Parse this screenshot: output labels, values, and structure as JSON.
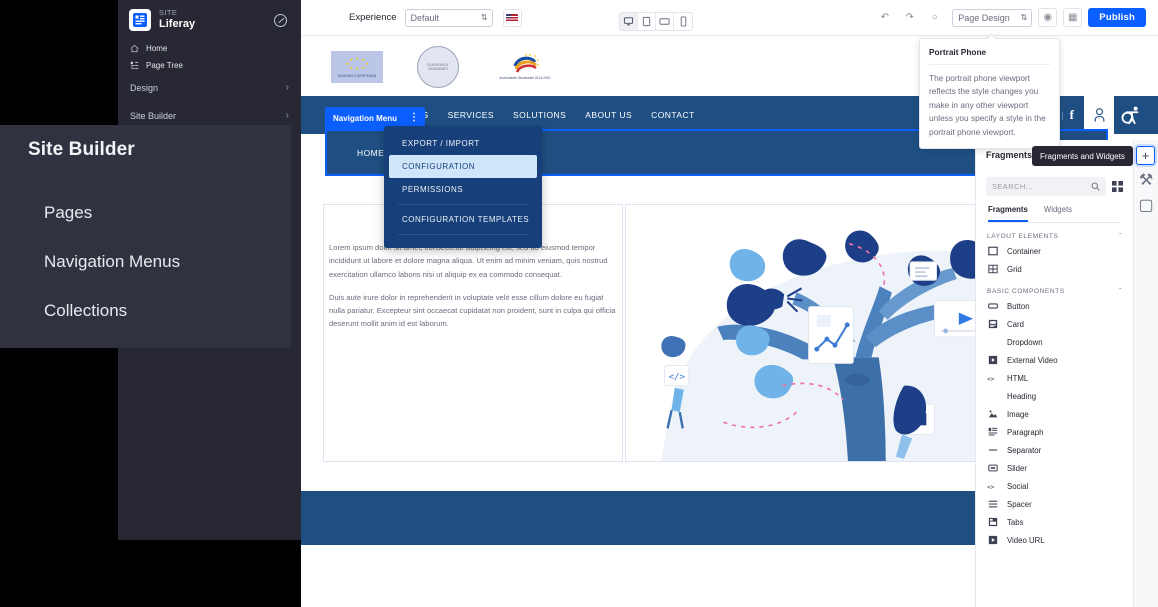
{
  "product_sidebar": {
    "kicker": "SITE",
    "site_name": "Liferay",
    "links": [
      {
        "label": "Home",
        "icon": "home-icon"
      },
      {
        "label": "Page Tree",
        "icon": "page-tree-icon"
      }
    ],
    "sections": [
      {
        "label": "Design",
        "chevron": "›"
      },
      {
        "label": "Site Builder",
        "chevron": "›"
      }
    ],
    "chevrons": [
      "›",
      "›",
      "›",
      "›",
      "›",
      "›"
    ]
  },
  "zoom_overlay": {
    "title": "Site Builder",
    "items": [
      "Pages",
      "Navigation Menus",
      "Collections"
    ]
  },
  "toolbar": {
    "experience_label": "Experience",
    "experience_value": "Default",
    "language_flag": "us-flag-icon",
    "viewports": [
      {
        "name": "desktop",
        "active": true
      },
      {
        "name": "tablet",
        "active": false
      },
      {
        "name": "landscape-phone",
        "active": false
      },
      {
        "name": "portrait-phone",
        "active": false
      }
    ],
    "undo": "↶",
    "redo": "↷",
    "history": "○",
    "page_design_value": "Page Design",
    "preview": "◉",
    "grid": "▦",
    "publish_label": "Publish"
  },
  "viewport_tooltip": {
    "title": "Portrait Phone",
    "body": "The portrait phone viewport reflects the style changes you make in any other viewport unless you specify a style in the portrait phone viewport."
  },
  "canvas": {
    "logos": [
      {
        "name": "eu-flag-logo",
        "caption": "UNIUNEA EUROPEANĂ"
      },
      {
        "name": "romania-government-seal",
        "caption": "GUVERNUL ROMÂNIEI"
      },
      {
        "name": "structural-instruments-logo",
        "caption": "Instrumente Structurale 2014-2020"
      }
    ],
    "nav_items": [
      "HOME",
      "PRODUCTS",
      "SERVICES",
      "SOLUTIONS",
      "ABOUT US",
      "CONTACT"
    ],
    "search_placeholder": "SEARCH...",
    "social": [
      "linkedin-icon",
      "youtube-icon",
      "facebook-icon"
    ],
    "user_icon": "user-account-icon",
    "accessibility_icon": "accessibility-icon",
    "fragment_label": "Navigation Menu",
    "fragment_kebab": "⋮",
    "second_nav_items": [
      "HOME",
      "P"
    ],
    "dropdown_items": [
      {
        "label": "EXPORT / IMPORT",
        "selected": false
      },
      {
        "label": "CONFIGURATION",
        "selected": true
      },
      {
        "label": "PERMISSIONS",
        "selected": false
      },
      {
        "label": "CONFIGURATION TEMPLATES",
        "selected": false
      }
    ],
    "paragraphs": [
      "Lorem ipsum dolor sit amet, consectetur adipiscing elit, sed do eiusmod tempor incididunt ut labore et dolore magna aliqua. Ut enim ad minim veniam, quis nostrud exercitation ullamco laboris nisi ut aliquip ex ea commodo consequat.",
      "Duis aute irure dolor in reprehenderit in voluptate velit esse cillum dolore eu fugiat nulla pariatur. Excepteur sint occaecat cupidatat non proident, sunt in culpa qui officia deserunt mollit anim id est laborum."
    ],
    "illustration_name": "blue-tree-illustration"
  },
  "right_panel": {
    "title": "Fragments a",
    "tooltip": "Fragments and Widgets",
    "add_button": "+",
    "search_placeholder": "SEARCH...",
    "search_icon": "search-icon",
    "view_toggle_icon": "grid-view-icon",
    "tabs": [
      {
        "label": "Fragments",
        "active": true
      },
      {
        "label": "Widgets",
        "active": false
      }
    ],
    "groups": [
      {
        "label": "LAYOUT ELEMENTS",
        "collapse": "ˇ",
        "items": [
          {
            "label": "Container",
            "icon": "container-icon"
          },
          {
            "label": "Grid",
            "icon": "grid-icon"
          }
        ]
      },
      {
        "label": "BASIC COMPONENTS",
        "collapse": "ˇ",
        "items": [
          {
            "label": "Button",
            "icon": "button-icon"
          },
          {
            "label": "Card",
            "icon": "card-icon"
          },
          {
            "label": "Dropdown",
            "icon": ""
          },
          {
            "label": "External Video",
            "icon": "video-icon"
          },
          {
            "label": "HTML",
            "icon": "code-icon"
          },
          {
            "label": "Heading",
            "icon": ""
          },
          {
            "label": "Image",
            "icon": "image-icon"
          },
          {
            "label": "Paragraph",
            "icon": "paragraph-icon"
          },
          {
            "label": "Separator",
            "icon": "separator-icon"
          },
          {
            "label": "Slider",
            "icon": "slider-icon"
          },
          {
            "label": "Social",
            "icon": "code-icon"
          },
          {
            "label": "Spacer",
            "icon": "spacer-icon"
          },
          {
            "label": "Tabs",
            "icon": "tabs-icon"
          },
          {
            "label": "Video URL",
            "icon": "video-icon"
          }
        ]
      }
    ],
    "rail": [
      {
        "name": "style-book-icon",
        "glyph": "⚒"
      },
      {
        "name": "comments-icon",
        "glyph": "▢"
      }
    ]
  },
  "colors": {
    "accent": "#0b5fff",
    "sidebar_bg": "#272833",
    "site_nav_blue": "#1f4f82",
    "menu_blue": "#17407a"
  }
}
